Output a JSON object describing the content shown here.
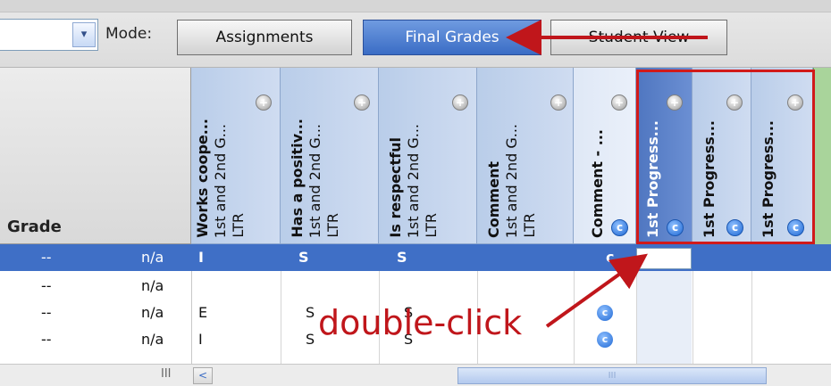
{
  "toolbar": {
    "dropdown_arrow": "▾",
    "mode_label": "Mode:",
    "modes": [
      "Assignments",
      "Final Grades",
      "Student View"
    ],
    "active_mode": "Final Grades"
  },
  "grade_header": "Grade",
  "columns": [
    {
      "title": "Works coope...",
      "sub": "1st and 2nd G...",
      "type": "LTR"
    },
    {
      "title": "Has a positiv...",
      "sub": "1st and 2nd G...",
      "type": "LTR"
    },
    {
      "title": "Is respectful",
      "sub": "1st and 2nd G...",
      "type": "LTR"
    },
    {
      "title": "Comment",
      "sub": "1st and 2nd G...",
      "type": "LTR"
    },
    {
      "title": "Comment - ...",
      "sub": "",
      "type": ""
    },
    {
      "title": "1st Progress...",
      "sub": "",
      "type": ""
    },
    {
      "title": "1st Progress...",
      "sub": "",
      "type": ""
    },
    {
      "title": "1st Progress...",
      "sub": "",
      "type": ""
    }
  ],
  "icons": {
    "plus": "plus-circle-icon",
    "comment": "comment-c-icon",
    "c_letter": "c"
  },
  "rows": [
    {
      "grade": "--",
      "value": "n/a",
      "c1": "I",
      "c2": "S",
      "c3": "S",
      "comment": "c"
    },
    {
      "grade": "--",
      "value": "n/a",
      "c1": "",
      "c2": "",
      "c3": "",
      "comment": ""
    },
    {
      "grade": "--",
      "value": "n/a",
      "c1": "E",
      "c2": "S",
      "c3": "S",
      "comment": "c"
    },
    {
      "grade": "--",
      "value": "n/a",
      "c1": "I",
      "c2": "S",
      "c3": "S",
      "comment": "c"
    }
  ],
  "annotation": "double-click",
  "scroll": {
    "left_arrow": "<",
    "indicator": "III",
    "thumb_grip": "III"
  },
  "colors": {
    "annotation": "#c0161b",
    "selection": "#3f6fc6",
    "highlight_box": "#d11a1a"
  }
}
